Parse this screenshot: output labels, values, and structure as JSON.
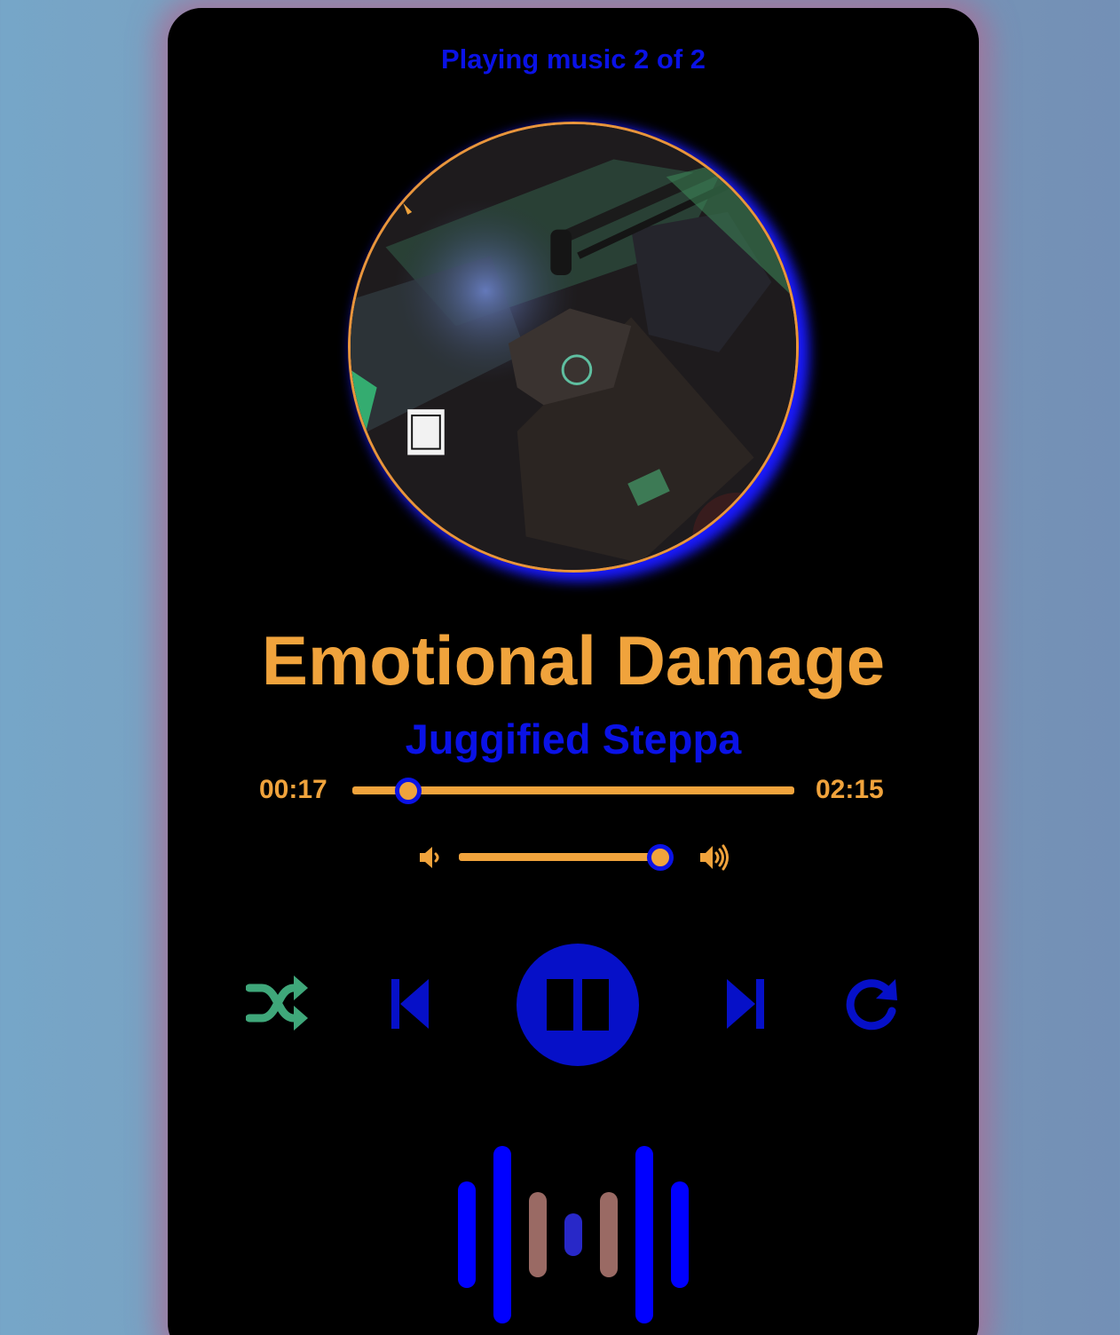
{
  "header": {
    "now_playing": "Playing music 2 of 2"
  },
  "track": {
    "title": "Emotional Damage",
    "artist": "Juggified Steppa",
    "current_time": "00:17",
    "total_time": "02:15",
    "progress": 0.126
  },
  "volume": {
    "level": 0.96
  },
  "controls": {
    "shuffle_icon": "shuffle-icon",
    "previous_icon": "skip-back-icon",
    "play_pause_icon": "pause-icon",
    "next_icon": "skip-forward-icon",
    "repeat_icon": "repeat-icon"
  },
  "colors": {
    "background": "#000000",
    "accent_orange": "#f0a33c",
    "accent_blue": "#0a12e6",
    "shuffle_green": "#3fa77a",
    "visualizer_brown": "#9a6a64"
  },
  "visualizer": {
    "levels": [
      0.6,
      1.0,
      0.48,
      0.24,
      0.48,
      1.0,
      0.6
    ],
    "colors": [
      "#0000ff",
      "#0000ff",
      "#9a6a64",
      "#2828c8",
      "#9a6a64",
      "#0000ff",
      "#0000ff"
    ]
  }
}
